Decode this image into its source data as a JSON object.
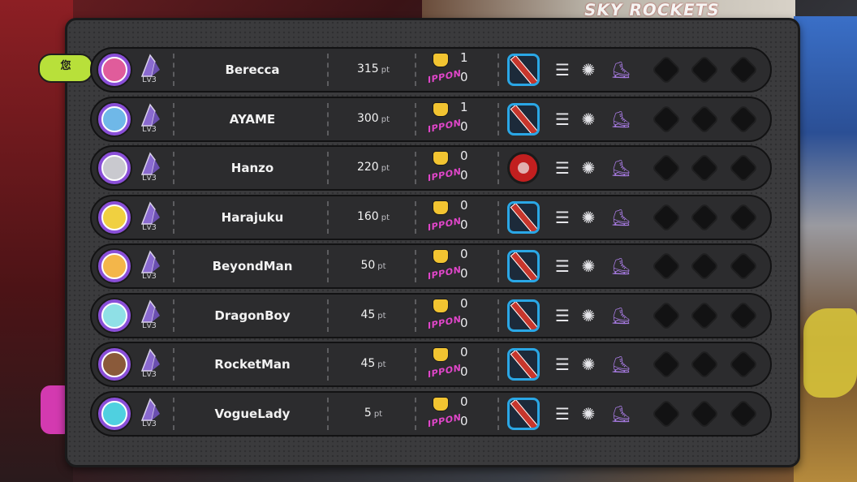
{
  "background": {
    "sign_text": "SKY ROCKETS"
  },
  "you_badge": {
    "label": "您"
  },
  "units": {
    "points": "pt",
    "level_prefix": "Lv",
    "ippon": "IPPON"
  },
  "colors": {
    "accent_lime": "#b8e03a",
    "ippon_pink": "#e046c9",
    "weapon_blue": "#2aa7e6",
    "avatar_purple": "#8a4fd8"
  },
  "players": [
    {
      "name": "Berecca",
      "level": "Lv3",
      "points": "315",
      "medal_count": "1",
      "ippon_count": "0",
      "weapon": "bat-icon",
      "avatar_color": "#e05c9b",
      "is_you": true
    },
    {
      "name": "AYAME",
      "level": "Lv3",
      "points": "300",
      "medal_count": "1",
      "ippon_count": "0",
      "weapon": "bat-icon",
      "avatar_color": "#6fb8e8"
    },
    {
      "name": "Hanzo",
      "level": "Lv3",
      "points": "220",
      "medal_count": "0",
      "ippon_count": "0",
      "weapon": "ball-icon",
      "avatar_color": "#c9c9cf"
    },
    {
      "name": "Harajuku",
      "level": "Lv3",
      "points": "160",
      "medal_count": "0",
      "ippon_count": "0",
      "weapon": "bat-icon",
      "avatar_color": "#f0d040"
    },
    {
      "name": "BeyondMan",
      "level": "Lv3",
      "points": "50",
      "medal_count": "0",
      "ippon_count": "0",
      "weapon": "bat-icon",
      "avatar_color": "#f3b64a"
    },
    {
      "name": "DragonBoy",
      "level": "Lv3",
      "points": "45",
      "medal_count": "0",
      "ippon_count": "0",
      "weapon": "bat-icon",
      "avatar_color": "#8fe0e6"
    },
    {
      "name": "RocketMan",
      "level": "Lv3",
      "points": "45",
      "medal_count": "0",
      "ippon_count": "0",
      "weapon": "bat-icon",
      "avatar_color": "#8a5a3a"
    },
    {
      "name": "VogueLady",
      "level": "Lv3",
      "points": "5",
      "medal_count": "0",
      "ippon_count": "0",
      "weapon": "bat-icon",
      "avatar_color": "#4fd0e0"
    }
  ]
}
